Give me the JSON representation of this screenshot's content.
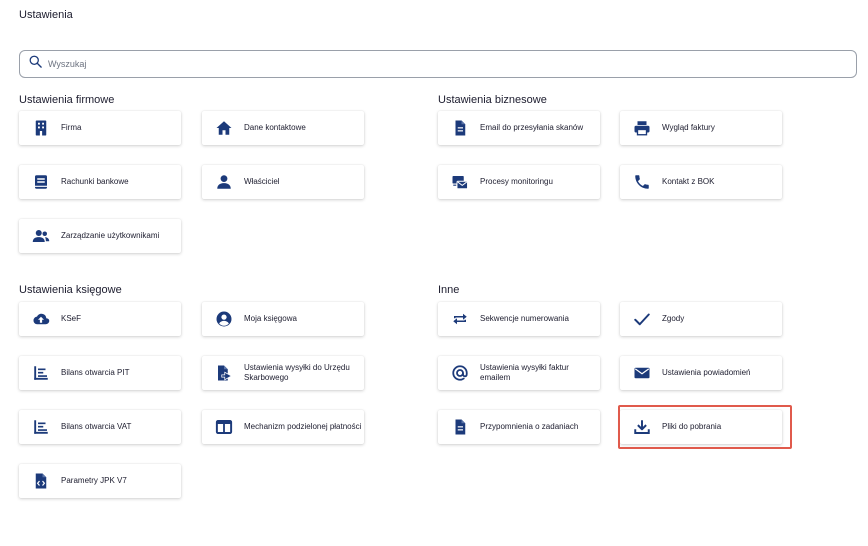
{
  "page": {
    "title": "Ustawienia"
  },
  "search": {
    "placeholder": "Wyszukaj"
  },
  "colors": {
    "icon": "#1c3a7a",
    "highlight": "#e05a4c"
  },
  "sections": {
    "firm": {
      "title": "Ustawienia firmowe"
    },
    "business": {
      "title": "Ustawienia biznesowe"
    },
    "accounting": {
      "title": "Ustawienia księgowe"
    },
    "other": {
      "title": "Inne"
    }
  },
  "tiles": {
    "firma": {
      "label": "Firma",
      "icon": "building-icon"
    },
    "dane_kontaktowe": {
      "label": "Dane kontaktowe",
      "icon": "home-icon"
    },
    "rachunki": {
      "label": "Rachunki bankowe",
      "icon": "bank-book-icon"
    },
    "wlasciciel": {
      "label": "Właściciel",
      "icon": "person-icon"
    },
    "uzytkownicy": {
      "label": "Zarządzanie użytkownikami",
      "icon": "users-icon"
    },
    "email_skanow": {
      "label": "Email do przesyłania skanów",
      "icon": "document-icon"
    },
    "wyglad_faktury": {
      "label": "Wygląd faktury",
      "icon": "printer-icon"
    },
    "procesy": {
      "label": "Procesy monitoringu",
      "icon": "monitor-mail-icon"
    },
    "kontakt_bok": {
      "label": "Kontakt z BOK",
      "icon": "phone-icon"
    },
    "ksef": {
      "label": "KSeF",
      "icon": "cloud-upload-icon"
    },
    "moja_ksiegowa": {
      "label": "Moja księgowa",
      "icon": "account-circle-icon"
    },
    "bilans_pit": {
      "label": "Bilans otwarcia PIT",
      "icon": "list-chart-icon"
    },
    "wysylka_us": {
      "label": "Ustawienia wysyłki do Urzędu Skarbowego",
      "icon": "file-send-icon"
    },
    "bilans_vat": {
      "label": "Bilans otwarcia VAT",
      "icon": "list-chart-icon"
    },
    "split": {
      "label": "Mechanizm podzielonej płatności",
      "icon": "split-columns-icon"
    },
    "jpk": {
      "label": "Parametry JPK V7",
      "icon": "code-file-icon"
    },
    "sekwencje": {
      "label": "Sekwencje numerowania",
      "icon": "repeat-icon"
    },
    "zgody": {
      "label": "Zgody",
      "icon": "check-icon"
    },
    "wysylka_email": {
      "label": "Ustawienia wysyłki faktur emailem",
      "icon": "at-icon"
    },
    "powiadomienia": {
      "label": "Ustawienia powiadomień",
      "icon": "envelope-icon"
    },
    "przypomnienia": {
      "label": "Przypomnienia o zadaniach",
      "icon": "document-icon"
    },
    "pliki": {
      "label": "Pliki do pobrania",
      "icon": "download-icon"
    }
  }
}
